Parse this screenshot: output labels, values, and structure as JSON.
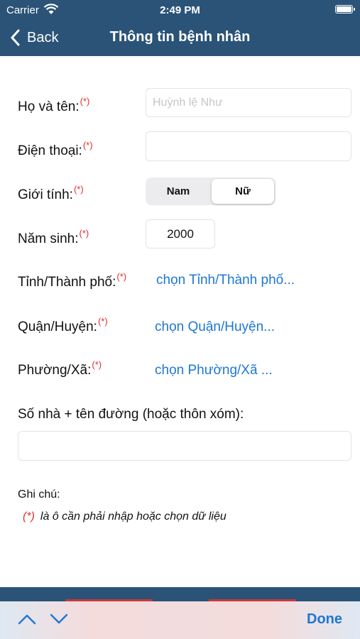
{
  "status_bar": {
    "carrier": "Carrier",
    "time": "2:49 PM"
  },
  "nav": {
    "back_label": "Back",
    "title": "Thông tin bệnh nhân"
  },
  "required_mark": "(*)",
  "form": {
    "full_name": {
      "label": "Họ và tên:",
      "placeholder": "Huỳnh lệ Như",
      "value": ""
    },
    "phone": {
      "label": "Điện thoại:",
      "value": ""
    },
    "gender": {
      "label": "Giới tính:",
      "options": [
        "Nam",
        "Nữ"
      ],
      "selected": "Nữ"
    },
    "birth_year": {
      "label": "Năm sinh:",
      "value": "2000"
    },
    "province": {
      "label": "Tỉnh/Thành phố:",
      "picker": "chọn Tỉnh/Thành phố..."
    },
    "district": {
      "label": "Quận/Huyện:",
      "picker": "chọn Quận/Huyện..."
    },
    "ward": {
      "label": "Phường/Xã:",
      "picker": "chọn Phường/Xã ..."
    },
    "street": {
      "label": "Số nhà + tên đường (hoặc thôn xóm):",
      "value": ""
    }
  },
  "note": {
    "title": "Ghi chú:",
    "star": "(*)",
    "text": "là ô cần phải nhập hoặc chọn dữ liệu"
  },
  "keyboard_toolbar": {
    "done_label": "Done",
    "icons": [
      "chevron-up-icon",
      "chevron-down-icon"
    ]
  },
  "colors": {
    "header": "#2a5377",
    "accent": "#1e77d3",
    "required": "#e0302f"
  }
}
